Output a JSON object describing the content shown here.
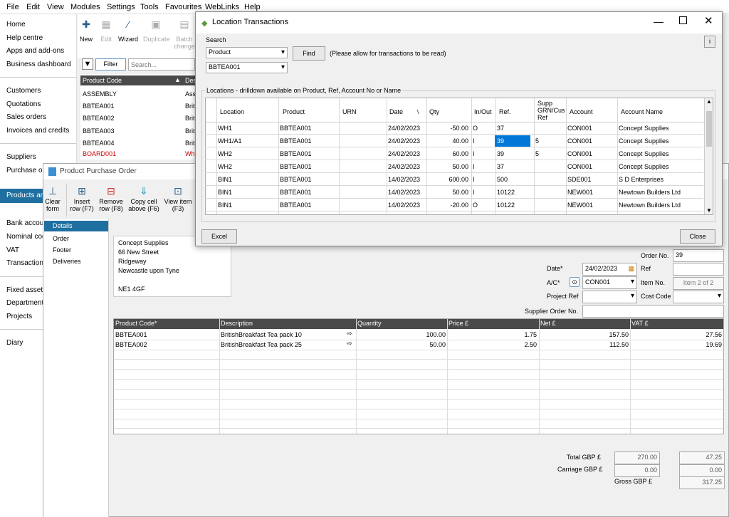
{
  "menu": [
    "File",
    "Edit",
    "View",
    "Modules",
    "Settings",
    "Tools",
    "Favourites",
    "WebLinks",
    "Help"
  ],
  "sidebar": {
    "items": [
      "Home",
      "Help centre",
      "Apps and add-ons",
      "Business dashboard",
      "Customers",
      "Quotations",
      "Sales orders",
      "Invoices and credits",
      "Suppliers",
      "Purchase ord",
      "Products and",
      "Bank account",
      "Nominal code",
      "VAT",
      "Transactions",
      "Fixed assets",
      "Departments",
      "Projects",
      "Diary"
    ]
  },
  "main_toolbar": {
    "new": "New",
    "edit": "Edit",
    "wizard": "Wizard",
    "duplicate": "Duplicate",
    "batch": "Batch",
    "batch2": "change"
  },
  "list": {
    "filter": "Filter",
    "search_placeholder": "Search...",
    "col_code": "Product Code",
    "col_desc": "Des",
    "rows": [
      {
        "code": "ASSEMBLY",
        "desc": "Ass"
      },
      {
        "code": "BBTEA001",
        "desc": "Brit"
      },
      {
        "code": "BBTEA002",
        "desc": "Brit"
      },
      {
        "code": "BBTEA003",
        "desc": "Brit"
      },
      {
        "code": "BBTEA004",
        "desc": "Brit"
      },
      {
        "code": "BOARD001",
        "desc": "Wh"
      }
    ]
  },
  "po": {
    "title": "Product Purchase Order",
    "toolbar": {
      "clear1": "Clear",
      "clear2": "form",
      "insert1": "Insert",
      "insert2": "row (F7)",
      "remove1": "Remove",
      "remove2": "row (F8)",
      "copy1": "Copy cell",
      "copy2": "above (F6)",
      "view1": "View item",
      "view2": "(F3)"
    },
    "nav": [
      "Details",
      "Order",
      "Footer",
      "Deliveries"
    ],
    "address": [
      "Concept Supplies",
      "66 New Street",
      "Ridgeway",
      "Newcastle upon Tyne",
      "",
      "NE1 4GF"
    ],
    "labels": {
      "order_no": "Order No.",
      "date": "Date*",
      "ref": "Ref",
      "ac": "A/C*",
      "item_no": "Item No.",
      "project_ref": "Project Ref",
      "cost_code": "Cost Code",
      "supplier_order_no": "Supplier Order No."
    },
    "values": {
      "order_no": "39",
      "date": "24/02/2023",
      "ac": "CON001",
      "item_no": "Item 2 of 2"
    },
    "grid": {
      "headers": [
        "Product Code*",
        "Description",
        "Quantity",
        "Price £",
        "Net £",
        "VAT £"
      ],
      "rows": [
        {
          "code": "BBTEA001",
          "desc": "BritishBreakfast  Tea pack 10",
          "qty": "100.00",
          "price": "1.75",
          "net": "157.50",
          "vat": "27.56"
        },
        {
          "code": "BBTEA002",
          "desc": "BritishBreakfast  Tea pack 25",
          "qty": "50.00",
          "price": "2.50",
          "net": "112.50",
          "vat": "19.69"
        }
      ]
    },
    "totals": {
      "total_label": "Total GBP £",
      "total_net": "270.00",
      "total_vat": "47.25",
      "carriage_label": "Carriage GBP £",
      "carriage_net": "0.00",
      "carriage_vat": "0.00",
      "gross_label": "Gross GBP £",
      "gross": "317.25"
    }
  },
  "lt": {
    "title": "Location Transactions",
    "search_label": "Search",
    "search_type": "Product",
    "search_value": "BBTEA001",
    "find": "Find",
    "note": "(Please allow for transactions to be read)",
    "section": "Locations - drilldown available on Product, Ref, Account No or Name",
    "headers": [
      "Location",
      "Product",
      "URN",
      "Date",
      "Qty",
      "In/Out",
      "Ref.",
      "Supp GRN/Cus Ref",
      "Account",
      "Account Name"
    ],
    "rows": [
      {
        "loc": "WH1",
        "prod": "BBTEA001",
        "urn": "",
        "date": "24/02/2023",
        "qty": "-50.00",
        "io": "O",
        "ref": "37",
        "supp": "",
        "acc": "CON001",
        "name": "Concept Supplies"
      },
      {
        "loc": "WH1/A1",
        "prod": "BBTEA001",
        "urn": "",
        "date": "24/02/2023",
        "qty": "40.00",
        "io": "I",
        "ref": "39",
        "supp": "5",
        "acc": "CON001",
        "name": "Concept Supplies"
      },
      {
        "loc": "WH2",
        "prod": "BBTEA001",
        "urn": "",
        "date": "24/02/2023",
        "qty": "60.00",
        "io": "I",
        "ref": "39",
        "supp": "5",
        "acc": "CON001",
        "name": "Concept Supplies"
      },
      {
        "loc": "WH2",
        "prod": "BBTEA001",
        "urn": "",
        "date": "24/02/2023",
        "qty": "50.00",
        "io": "I",
        "ref": "37",
        "supp": "",
        "acc": "CON001",
        "name": "Concept Supplies"
      },
      {
        "loc": "BIN1",
        "prod": "BBTEA001",
        "urn": "",
        "date": "14/02/2023",
        "qty": "600.00",
        "io": "I",
        "ref": "500",
        "supp": "",
        "acc": "SDE001",
        "name": "S D Enterprises"
      },
      {
        "loc": "BIN1",
        "prod": "BBTEA001",
        "urn": "",
        "date": "14/02/2023",
        "qty": "50.00",
        "io": "I",
        "ref": "10122",
        "supp": "",
        "acc": "NEW001",
        "name": "Newtown Builders Ltd"
      },
      {
        "loc": "BIN1",
        "prod": "BBTEA001",
        "urn": "",
        "date": "14/02/2023",
        "qty": "-20.00",
        "io": "O",
        "ref": "10122",
        "supp": "",
        "acc": "NEW001",
        "name": "Newtown Builders Ltd"
      }
    ],
    "excel": "Excel",
    "close": "Close",
    "info": "i"
  },
  "colors": {
    "accent": "#1f6fa0",
    "selection": "#0078d7",
    "header_dark": "#4a4a4a",
    "red_text": "#d00000"
  }
}
